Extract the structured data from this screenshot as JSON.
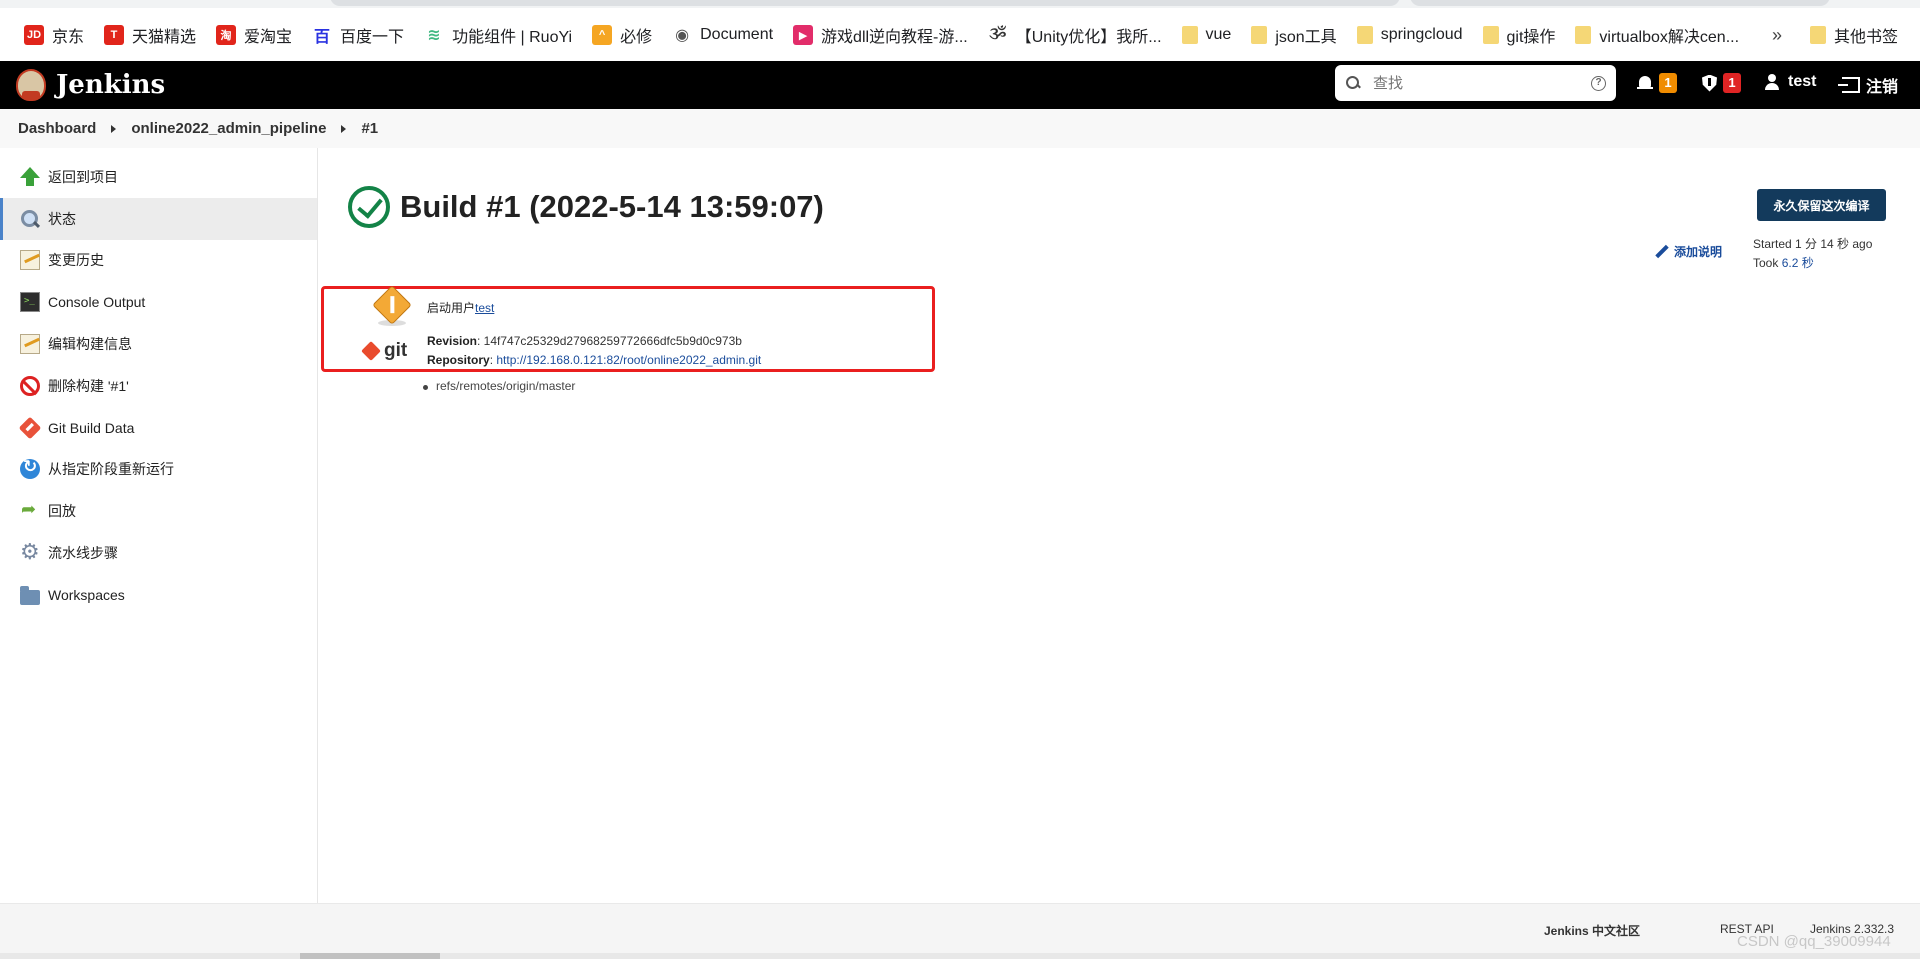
{
  "bookmarks": {
    "items": [
      {
        "label": "京东",
        "icon": "jd-icon",
        "color": "#e1251b",
        "glyph": "JD"
      },
      {
        "label": "天猫精选",
        "icon": "tmall-icon",
        "color": "#e1251b",
        "glyph": "T"
      },
      {
        "label": "爱淘宝",
        "icon": "taobao-icon",
        "color": "#e1251b",
        "glyph": "淘"
      },
      {
        "label": "百度一下",
        "icon": "baidu-icon",
        "color": "#2932e1",
        "glyph": "百"
      },
      {
        "label": "功能组件 | RuoYi",
        "icon": "ruoyi-icon",
        "color": "#42b983",
        "glyph": "≋"
      },
      {
        "label": "必修",
        "icon": "bixiu-icon",
        "color": "#f5a623",
        "glyph": "^"
      },
      {
        "label": "Document",
        "icon": "globe-icon",
        "color": "#555555",
        "glyph": "◉"
      },
      {
        "label": "游戏dll逆向教程-游...",
        "icon": "video-icon",
        "color": "#e22d6a",
        "glyph": "▶"
      },
      {
        "label": "【Unity优化】我所...",
        "icon": "csdn-icon",
        "color": "#333333",
        "glyph": "ૐ"
      },
      {
        "label": "vue",
        "icon": "folder-icon",
        "color": "",
        "glyph": ""
      },
      {
        "label": "json工具",
        "icon": "folder-icon",
        "color": "",
        "glyph": ""
      },
      {
        "label": "springcloud",
        "icon": "folder-icon",
        "color": "",
        "glyph": ""
      },
      {
        "label": "git操作",
        "icon": "folder-icon",
        "color": "",
        "glyph": ""
      },
      {
        "label": "virtualbox解决cen...",
        "icon": "folder-icon",
        "color": "",
        "glyph": ""
      }
    ],
    "more": "»",
    "other": "其他书签"
  },
  "header": {
    "logo_text": "Jenkins",
    "search_placeholder": "查找",
    "notifications_count": "1",
    "security_count": "1",
    "username": "test",
    "logout_label": "注销"
  },
  "breadcrumb": [
    "Dashboard",
    "online2022_admin_pipeline",
    "#1"
  ],
  "sidebar": {
    "items": [
      {
        "label": "返回到项目",
        "icon": "ic-up",
        "name": "back-to-project"
      },
      {
        "label": "状态",
        "icon": "ic-mag",
        "name": "status",
        "active": true
      },
      {
        "label": "变更历史",
        "icon": "ic-note",
        "name": "changes"
      },
      {
        "label": "Console Output",
        "icon": "ic-console",
        "name": "console-output"
      },
      {
        "label": "编辑构建信息",
        "icon": "ic-note",
        "name": "edit-build-info"
      },
      {
        "label": "删除构建 '#1'",
        "icon": "ic-nodel",
        "name": "delete-build"
      },
      {
        "label": "Git Build Data",
        "icon": "ic-git",
        "name": "git-build-data"
      },
      {
        "label": "从指定阶段重新运行",
        "icon": "ic-restart",
        "name": "restart-from-stage"
      },
      {
        "label": "回放",
        "icon": "ic-replay",
        "name": "replay"
      },
      {
        "label": "流水线步骤",
        "icon": "ic-gear",
        "name": "pipeline-steps"
      },
      {
        "label": "Workspaces",
        "icon": "ic-folder",
        "name": "workspaces"
      }
    ]
  },
  "main": {
    "title": "Build #1 (2022-5-14 13:59:07)",
    "keep_button": "永久保留这次编译",
    "add_description": "添加说明",
    "started_ago": "Started 1 分 14 秒 ago",
    "took_label": "Took ",
    "took_value": "6.2 秒",
    "started_by_label": "启动用户",
    "started_by_user": "test",
    "revision_label": "Revision",
    "revision_value": ": 14f747c25329d27968259772666dfc5b9d0c973b",
    "repository_label": "Repository",
    "repository_sep": ": ",
    "repository_url": "http://192.168.0.121:82/root/online2022_admin.git",
    "ref": "refs/remotes/origin/master",
    "git_logo": "git"
  },
  "footer": {
    "community": "Jenkins 中文社区",
    "rest_api": "REST API",
    "version": "Jenkins 2.332.3"
  },
  "watermark": "CSDN @qq_39009944"
}
